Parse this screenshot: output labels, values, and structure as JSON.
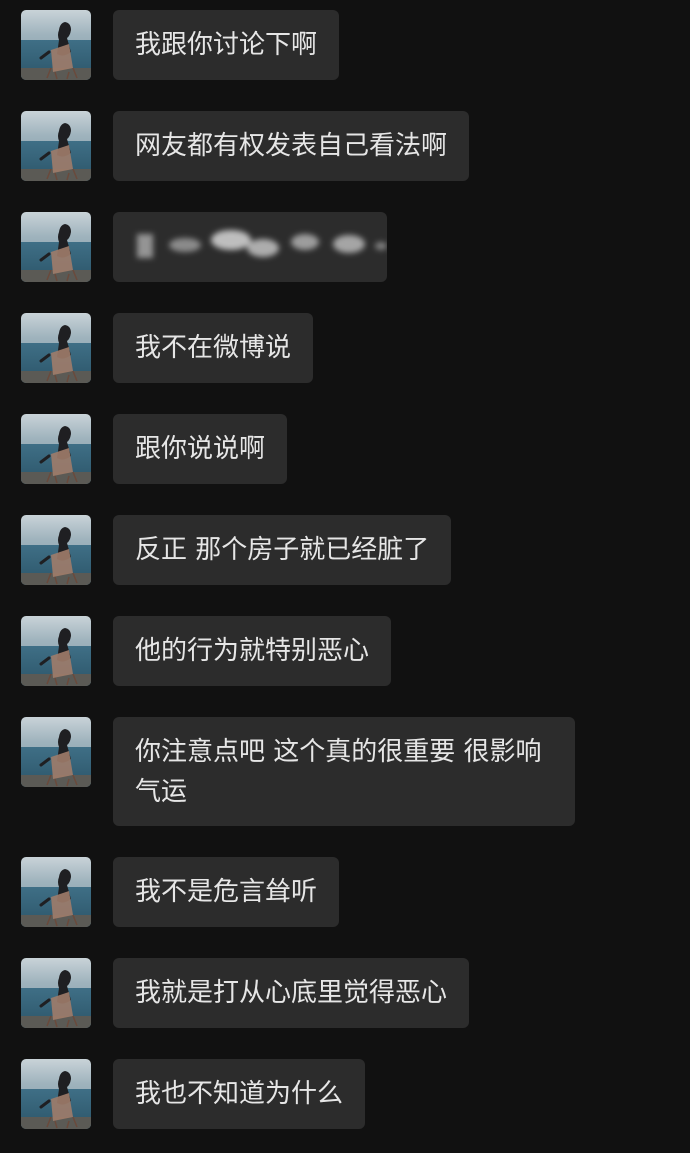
{
  "chat": {
    "messages": [
      {
        "text": "我跟你讨论下啊"
      },
      {
        "text": "网友都有权发表自己看法啊"
      },
      {
        "text": "",
        "blurred": true
      },
      {
        "text": "我不在微博说"
      },
      {
        "text": "跟你说说啊"
      },
      {
        "text": "反正 那个房子就已经脏了"
      },
      {
        "text": "他的行为就特别恶心"
      },
      {
        "text": "你注意点吧 这个真的很重要 很影响气运"
      },
      {
        "text": "我不是危言耸听"
      },
      {
        "text": "我就是打从心底里觉得恶心"
      },
      {
        "text": "我也不知道为什么"
      }
    ]
  },
  "colors": {
    "background": "#111111",
    "bubble": "#2c2c2c",
    "text": "#e6e6e6"
  }
}
